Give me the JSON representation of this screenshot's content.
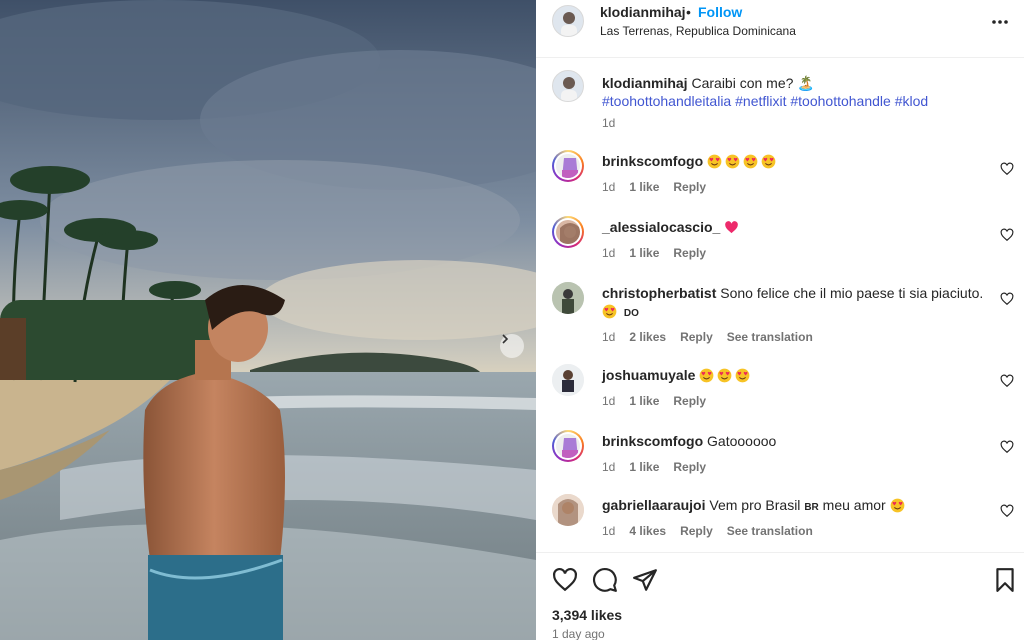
{
  "post": {
    "username": "klodianmihaj",
    "dot": "•",
    "follow_label": "Follow",
    "location": "Las Terrenas, Republica Dominicana",
    "more_icon": "more-horizontal-icon",
    "image_alt_icons": [
      "chevron-right-icon"
    ]
  },
  "caption": {
    "username": "klodianmihaj",
    "text": "Caraibi con me?",
    "emoji": "🏝️",
    "hashtags": [
      "#toohottohandleitalia",
      "#netflixit",
      "#toohottohandle",
      "#klod"
    ],
    "time": "1d"
  },
  "comments": [
    {
      "username": "brinkscomfogo",
      "text": "",
      "emoji_count": 4,
      "time": "1d",
      "likes": "1 like",
      "reply": "Reply",
      "translate": ""
    },
    {
      "username": "_alessialocascio_",
      "text": "",
      "emoji_count": 0,
      "heart": true,
      "time": "1d",
      "likes": "1 like",
      "reply": "Reply",
      "translate": ""
    },
    {
      "username": "christopherbatist",
      "text": "Sono felice che il mio paese ti sia piaciuto.",
      "second_line": "DO",
      "time": "1d",
      "likes": "2 likes",
      "reply": "Reply",
      "translate": "See translation"
    },
    {
      "username": "joshuamuyale",
      "text": "",
      "emoji_count": 3,
      "time": "1d",
      "likes": "1 like",
      "reply": "Reply",
      "translate": ""
    },
    {
      "username": "brinkscomfogo",
      "text": "Gatoooooo",
      "time": "1d",
      "likes": "1 like",
      "reply": "Reply",
      "translate": ""
    },
    {
      "username": "gabriellaaraujoi",
      "text": "Vem pro Brasil",
      "flag": "BR",
      "text2": "meu amor",
      "time": "1d",
      "likes": "4 likes",
      "reply": "Reply",
      "translate": "See translation"
    }
  ],
  "footer": {
    "likes": "3,394 likes",
    "date": "1 day ago"
  },
  "colors": {
    "accent": "#0095f6",
    "hashtag": "#4156d1",
    "secondary_text": "#737373",
    "emoji_face": "#f7c325",
    "heart_eyes": "#ed2a55"
  }
}
